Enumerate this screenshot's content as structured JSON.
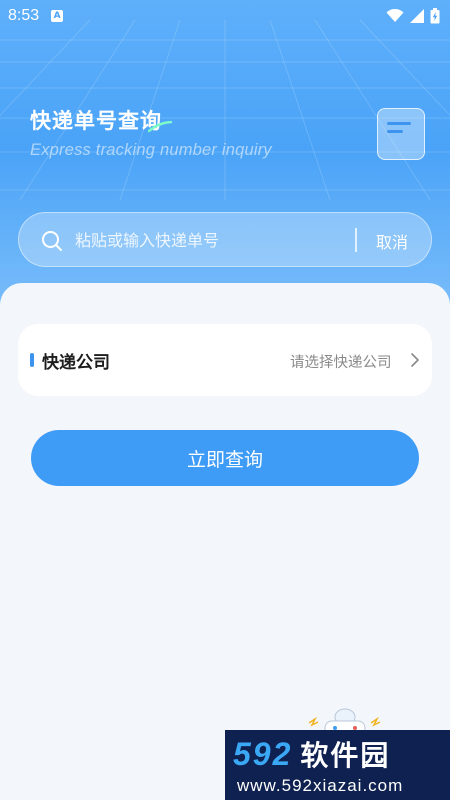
{
  "status_bar": {
    "time": "8:53",
    "notification_badge": "A",
    "icons": [
      "wifi-icon",
      "signal-icon",
      "battery-charging-icon"
    ]
  },
  "header": {
    "title": "快递单号查询",
    "subtitle": "Express tracking number inquiry",
    "icon": "document-icon"
  },
  "search": {
    "placeholder": "粘贴或输入快递单号",
    "value": "",
    "cancel_label": "取消",
    "icon": "search-icon"
  },
  "courier_company": {
    "label": "快递公司",
    "value": "请选择快递公司",
    "icon": "chevron-right-icon"
  },
  "query_button": {
    "label": "立即查询"
  },
  "watermark": {
    "number": "592",
    "brand": "软件园",
    "url": "www.592xiazai.com"
  },
  "colors": {
    "primary": "#3f9cf6",
    "header_gradient_top": "#5fb0fb",
    "background": "#f3f6fb",
    "watermark_bg": "#0f2150"
  }
}
